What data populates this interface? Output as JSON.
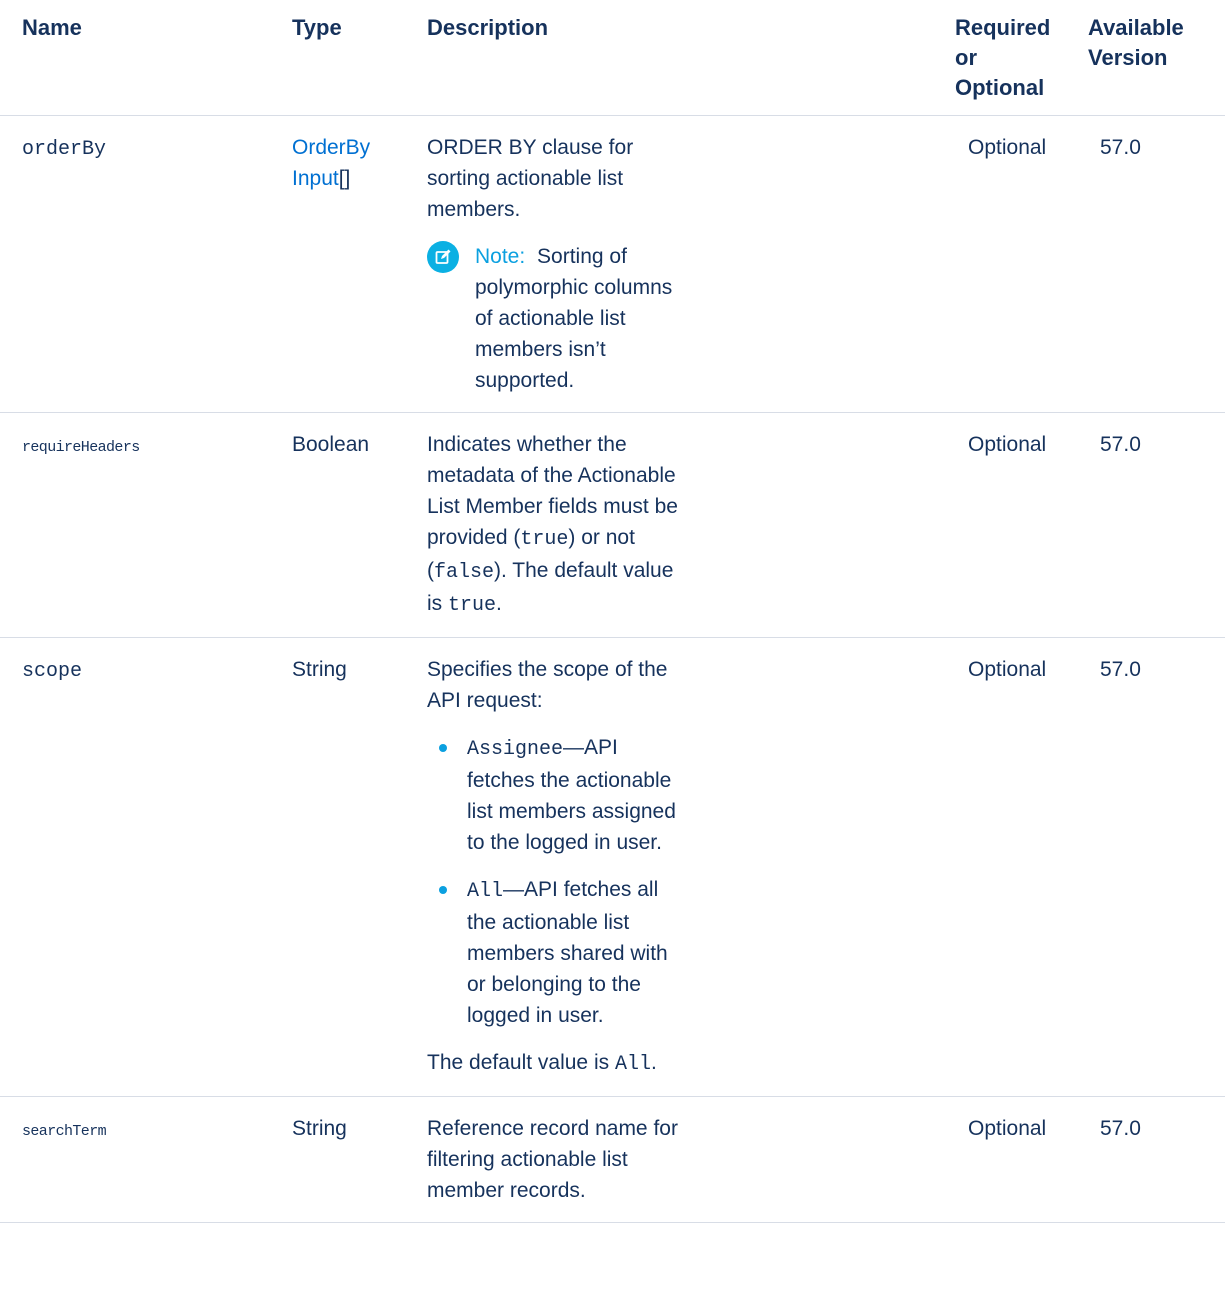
{
  "headers": {
    "name": "Name",
    "type": "Type",
    "description": "Description",
    "required_l1": "Required",
    "required_l2": "or",
    "required_l3": "Optional",
    "version_l1": "Available",
    "version_l2": "Version"
  },
  "rows": [
    {
      "name": "orderBy",
      "type_link_l1": "OrderBy",
      "type_link_l2": "Input",
      "type_suffix": "[]",
      "description": "ORDER BY clause for sorting actionable list members.",
      "note_label": "Note:",
      "note_text": "Sorting of polymorphic columns of actionable list members isn’t supported.",
      "required": "Optional",
      "version": "57.0"
    },
    {
      "name": "requireHeaders",
      "type": "Boolean",
      "desc_part1": "Indicates whether the metadata of the Actionable List Member fields must be provided (",
      "desc_code1": "true",
      "desc_part2": ") or not (",
      "desc_code2": "false",
      "desc_part3": "). The default value is ",
      "desc_code3": "true",
      "desc_part4": ".",
      "required": "Optional",
      "version": "57.0"
    },
    {
      "name": "scope",
      "type": "String",
      "description": "Specifies the scope of the API request:",
      "bullets": [
        {
          "code": "Assignee",
          "text": "—API fetches the actionable list members assigned to the logged in user."
        },
        {
          "code": "All",
          "text": "—API fetches all the actionable list members shared with or belonging to the logged in user."
        }
      ],
      "default_prefix": "The default value is ",
      "default_code": "All",
      "default_suffix": ".",
      "required": "Optional",
      "version": "57.0"
    },
    {
      "name": "searchTerm",
      "type": "String",
      "description": "Reference record name for filtering actionable list member records.",
      "required": "Optional",
      "version": "57.0"
    }
  ],
  "colors": {
    "text": "#16325c",
    "link": "#0070d2",
    "accent": "#0ba0e0",
    "border": "#d8dde6"
  },
  "icons": {
    "note": "edit-note-icon",
    "bullet": "bullet-dot-icon"
  }
}
